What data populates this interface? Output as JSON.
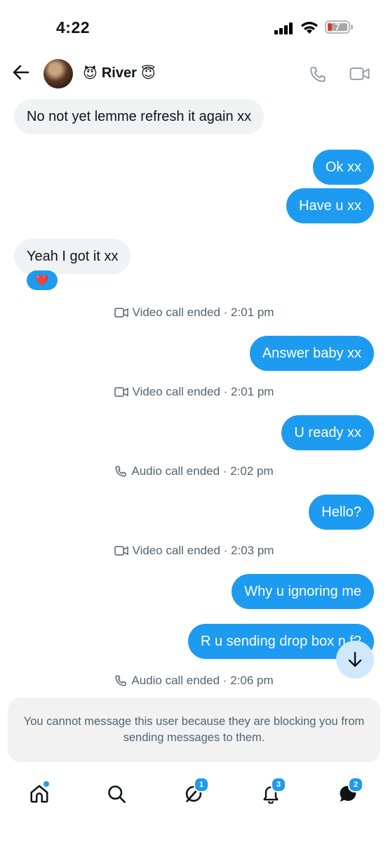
{
  "status_bar": {
    "time": "4:22",
    "battery": "7"
  },
  "header": {
    "name": "River",
    "emoji_left": "😈",
    "emoji_right": "😇"
  },
  "messages": [
    {
      "side": "in",
      "text": "No not yet lemme refresh it again xx"
    },
    {
      "side": "out",
      "text": "Ok xx"
    },
    {
      "side": "out",
      "text": "Have u xx"
    },
    {
      "side": "in",
      "text": "Yeah I got it xx",
      "reaction": "❤️"
    },
    {
      "side": "out",
      "text": "Answer baby xx"
    },
    {
      "side": "out",
      "text": "U ready xx"
    },
    {
      "side": "out",
      "text": "Hello?"
    },
    {
      "side": "out",
      "text": "Why u ignoring me"
    },
    {
      "side": "out",
      "text": "R u sending drop box n f?"
    }
  ],
  "calls": [
    {
      "type": "video",
      "text": "Video call ended · 2:01 pm"
    },
    {
      "type": "video",
      "text": "Video call ended · 2:01 pm"
    },
    {
      "type": "audio",
      "text": "Audio call ended · 2:02 pm"
    },
    {
      "type": "video",
      "text": "Video call ended · 2:03 pm"
    },
    {
      "type": "audio",
      "text": "Audio call ended · 2:06 pm"
    }
  ],
  "blocked_notice": "You cannot message this user because they are blocking you from sending messages to them.",
  "tabs": [
    {
      "name": "home",
      "badge": ""
    },
    {
      "name": "search",
      "badge": ""
    },
    {
      "name": "grok",
      "badge": "1"
    },
    {
      "name": "notifications",
      "badge": "3"
    },
    {
      "name": "messages",
      "badge": "2"
    }
  ],
  "icons": {
    "back": "arrow-left-icon",
    "phone": "phone-icon",
    "video": "video-camera-icon",
    "scroll_down": "arrow-down-icon"
  },
  "colors": {
    "accent": "#1d9bf0",
    "incoming": "#eff3f4",
    "meta_text": "#536471"
  }
}
